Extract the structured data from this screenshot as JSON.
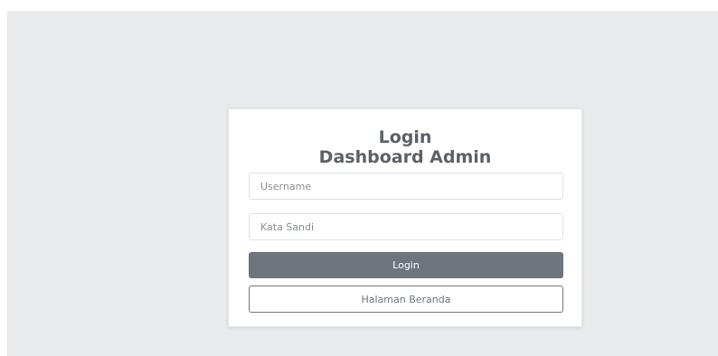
{
  "login": {
    "title_line1": "Login",
    "title_line2": "Dashboard Admin",
    "username_placeholder": "Username",
    "password_placeholder": "Kata Sandi",
    "login_button_label": "Login",
    "home_button_label": "Halaman Beranda"
  },
  "colors": {
    "background": "#e8eaec",
    "card": "#ffffff",
    "primary_button": "#6c757d",
    "title_text": "#5b6168"
  }
}
